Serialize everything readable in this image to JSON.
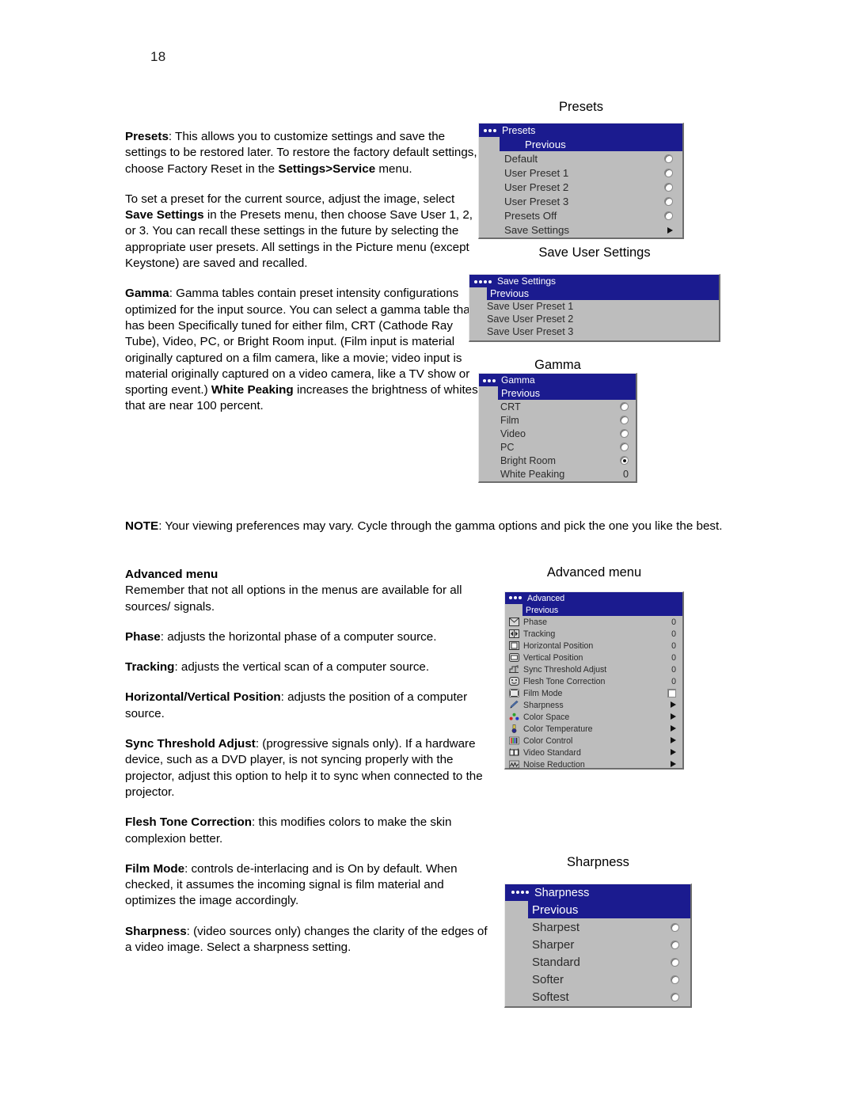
{
  "page": {
    "number": "18"
  },
  "paragraphs": [
    {
      "id": "p-presets",
      "runs": [
        {
          "t": "Presets",
          "b": true
        },
        {
          "t": ": This allows you to customize settings and save the settings to be restored later. To restore the factory default settings, choose Factory Reset in the ",
          "b": false
        },
        {
          "t": "Settings>Service",
          "b": true
        },
        {
          "t": " menu.",
          "b": false
        }
      ]
    },
    {
      "id": "p-setpreset",
      "runs": [
        {
          "t": "To set a preset for the current source, adjust the image, select ",
          "b": false
        },
        {
          "t": "Save Settings",
          "b": true
        },
        {
          "t": " in the Presets menu, then choose Save User 1, 2, or 3. You can recall these settings in the future by selecting the appropriate user presets. All settings in the Picture menu (except Keystone) are saved and recalled.",
          "b": false
        }
      ]
    },
    {
      "id": "p-gamma",
      "runs": [
        {
          "t": "Gamma",
          "b": true
        },
        {
          "t": ": Gamma tables contain preset intensity configurations optimized for the input source. You can select a gamma table that has been Specifically tuned for either film, CRT (Cathode Ray Tube), Video, PC, or Bright Room input. (Film input is material originally captured on a film camera, like a movie; video input is material originally captured on a video camera, like a TV show or sporting event.) ",
          "b": false
        },
        {
          "t": "White Peaking",
          "b": true
        },
        {
          "t": " increases the brightness of whites that are near 100 percent.",
          "b": false
        }
      ]
    },
    {
      "id": "p-note",
      "runs": [
        {
          "t": "NOTE",
          "b": true
        },
        {
          "t": ": Your viewing preferences may vary. Cycle through the gamma options and pick the one you like the best.",
          "b": false
        }
      ]
    },
    {
      "id": "p-advanced",
      "runs": [
        {
          "t": "Advanced menu",
          "b": true
        },
        {
          "t": "\nRemember that not all options in the menus are available for all sources/ signals.",
          "b": false
        }
      ]
    },
    {
      "id": "p-phase",
      "runs": [
        {
          "t": "Phase",
          "b": true
        },
        {
          "t": ": adjusts the horizontal phase of a computer source.",
          "b": false
        }
      ]
    },
    {
      "id": "p-tracking",
      "runs": [
        {
          "t": "Tracking",
          "b": true
        },
        {
          "t": ": adjusts the vertical scan of a computer source.",
          "b": false
        }
      ]
    },
    {
      "id": "p-hvpos",
      "runs": [
        {
          "t": "Horizontal/Vertical Position",
          "b": true
        },
        {
          "t": ": adjusts the position of a computer source.",
          "b": false
        }
      ]
    },
    {
      "id": "p-sync",
      "runs": [
        {
          "t": "Sync Threshold Adjust",
          "b": true
        },
        {
          "t": ": (progressive signals only). If a hardware device, such as a DVD player, is not syncing properly with the projector, adjust this option to help it to sync when connected to the projector.",
          "b": false
        }
      ]
    },
    {
      "id": "p-flesh",
      "runs": [
        {
          "t": "Flesh Tone Correction",
          "b": true
        },
        {
          "t": ": this modifies colors to make the skin complexion better.",
          "b": false
        }
      ]
    },
    {
      "id": "p-film",
      "runs": [
        {
          "t": "Film Mode",
          "b": true
        },
        {
          "t": ": controls de-interlacing and is On by default. When checked, it assumes the incoming signal is film material and optimizes the image accordingly.",
          "b": false
        }
      ]
    },
    {
      "id": "p-sharpness",
      "runs": [
        {
          "t": "Sharpness",
          "b": true
        },
        {
          "t": ": (video sources only) changes the clarity of the edges of a video image. Select a sharpness setting.",
          "b": false
        }
      ]
    }
  ],
  "captions": {
    "presets": "Presets",
    "save_user_settings": "Save User Settings",
    "gamma": "Gamma",
    "advanced": "Advanced menu",
    "sharpness": "Sharpness"
  },
  "menus": {
    "presets": {
      "title": "Presets",
      "dots": 3,
      "previous": "Previous",
      "rows": [
        {
          "label": "Default",
          "control": "radio",
          "selected": false
        },
        {
          "label": "User Preset 1",
          "control": "radio",
          "selected": false
        },
        {
          "label": "User Preset 2",
          "control": "radio",
          "selected": false
        },
        {
          "label": "User Preset 3",
          "control": "radio",
          "selected": false
        },
        {
          "label": "Presets Off",
          "control": "radio",
          "selected": false
        },
        {
          "label": "Save Settings",
          "control": "arrow"
        }
      ]
    },
    "save_settings": {
      "title": "Save Settings",
      "dots": 4,
      "previous": "Previous",
      "rows": [
        {
          "label": "Save User Preset 1",
          "control": "none"
        },
        {
          "label": "Save User Preset 2",
          "control": "none"
        },
        {
          "label": "Save User Preset 3",
          "control": "none"
        }
      ]
    },
    "gamma": {
      "title": "Gamma",
      "dots": 3,
      "previous": "Previous",
      "rows": [
        {
          "label": "CRT",
          "control": "radio",
          "selected": false
        },
        {
          "label": "Film",
          "control": "radio",
          "selected": false
        },
        {
          "label": "Video",
          "control": "radio",
          "selected": false
        },
        {
          "label": "PC",
          "control": "radio",
          "selected": false
        },
        {
          "label": "Bright Room",
          "control": "radio",
          "selected": true
        },
        {
          "label": "White Peaking",
          "control": "value",
          "value": "0"
        }
      ]
    },
    "advanced": {
      "title": "Advanced",
      "dots": 3,
      "previous": "Previous",
      "rows": [
        {
          "label": "Phase",
          "icon": "phase-icon",
          "control": "value",
          "value": "0"
        },
        {
          "label": "Tracking",
          "icon": "tracking-icon",
          "control": "value",
          "value": "0"
        },
        {
          "label": "Horizontal Position",
          "icon": "horizontal-position-icon",
          "control": "value",
          "value": "0"
        },
        {
          "label": "Vertical Position",
          "icon": "vertical-position-icon",
          "control": "value",
          "value": "0"
        },
        {
          "label": "Sync Threshold Adjust",
          "icon": "sync-threshold-icon",
          "control": "value",
          "value": "0"
        },
        {
          "label": "Flesh Tone Correction",
          "icon": "flesh-tone-icon",
          "control": "value",
          "value": "0"
        },
        {
          "label": "Film Mode",
          "icon": "film-mode-icon",
          "control": "checkbox",
          "checked": false
        },
        {
          "label": "Sharpness",
          "icon": "sharpness-icon",
          "control": "arrow"
        },
        {
          "label": "Color Space",
          "icon": "color-space-icon",
          "control": "arrow"
        },
        {
          "label": "Color Temperature",
          "icon": "color-temperature-icon",
          "control": "arrow"
        },
        {
          "label": "Color Control",
          "icon": "color-control-icon",
          "control": "arrow"
        },
        {
          "label": "Video Standard",
          "icon": "video-standard-icon",
          "control": "arrow"
        },
        {
          "label": "Noise Reduction",
          "icon": "noise-reduction-icon",
          "control": "arrow"
        }
      ]
    },
    "sharpness": {
      "title": "Sharpness",
      "dots": 4,
      "previous": "Previous",
      "rows": [
        {
          "label": "Sharpest",
          "control": "radio",
          "selected": false
        },
        {
          "label": "Sharper",
          "control": "radio",
          "selected": false
        },
        {
          "label": "Standard",
          "control": "radio",
          "selected": false
        },
        {
          "label": "Softer",
          "control": "radio",
          "selected": false
        },
        {
          "label": "Softest",
          "control": "radio",
          "selected": false
        }
      ]
    }
  },
  "colors": {
    "menu_title_bg": "#1b1b8f",
    "menu_body_bg": "#bdbdbd",
    "menu_text": "#2b2b2b",
    "highlight_text": "#ffffff"
  }
}
